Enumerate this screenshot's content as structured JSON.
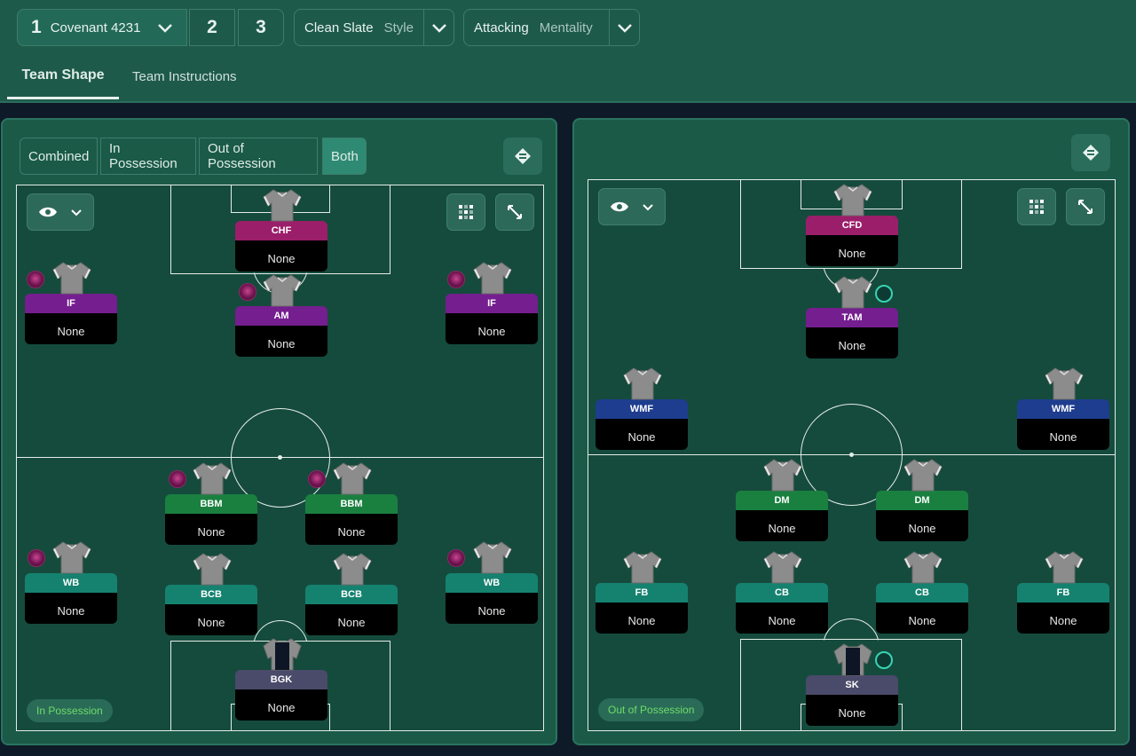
{
  "topbar": {
    "tactic": {
      "number": "1",
      "name": "Covenant 4231"
    },
    "slots": [
      "2",
      "3"
    ],
    "style": {
      "value": "Clean Slate",
      "label": "Style"
    },
    "mentality": {
      "value": "Attacking",
      "label": "Mentality"
    }
  },
  "tabs": {
    "team_shape": "Team Shape",
    "team_instructions": "Team Instructions"
  },
  "filters": {
    "combined": "Combined",
    "in_possession": "In Possession",
    "out_of_possession": "Out of Possession",
    "both": "Both",
    "selected": "Both"
  },
  "colors": {
    "accent": "#2e8a72",
    "pitch": "#154b3c",
    "panel": "#1a5a47",
    "role_magenta": "#9b1e6a",
    "role_purple": "#751e8f",
    "role_green": "#1a8040",
    "role_teal": "#158270",
    "role_blue": "#1e3d8f",
    "role_slate": "#4a4a6a",
    "phase_label": "#6fdc68"
  },
  "left_pitch": {
    "phase_label": "In Possession",
    "players": [
      {
        "role": "CHF",
        "name": "None",
        "color": "#9b1e6a"
      },
      {
        "role": "IF",
        "name": "None",
        "color": "#751e8f"
      },
      {
        "role": "AM",
        "name": "None",
        "color": "#751e8f"
      },
      {
        "role": "IF",
        "name": "None",
        "color": "#751e8f"
      },
      {
        "role": "BBM",
        "name": "None",
        "color": "#1a8040"
      },
      {
        "role": "BBM",
        "name": "None",
        "color": "#1a8040"
      },
      {
        "role": "WB",
        "name": "None",
        "color": "#158270"
      },
      {
        "role": "BCB",
        "name": "None",
        "color": "#158270"
      },
      {
        "role": "BCB",
        "name": "None",
        "color": "#158270"
      },
      {
        "role": "WB",
        "name": "None",
        "color": "#158270"
      },
      {
        "role": "BGK",
        "name": "None",
        "color": "#4a4a6a"
      }
    ]
  },
  "right_pitch": {
    "phase_label": "Out of Possession",
    "players": [
      {
        "role": "CFD",
        "name": "None",
        "color": "#9b1e6a"
      },
      {
        "role": "TAM",
        "name": "None",
        "color": "#751e8f"
      },
      {
        "role": "WMF",
        "name": "None",
        "color": "#1e3d8f"
      },
      {
        "role": "WMF",
        "name": "None",
        "color": "#1e3d8f"
      },
      {
        "role": "DM",
        "name": "None",
        "color": "#1a8040"
      },
      {
        "role": "DM",
        "name": "None",
        "color": "#1a8040"
      },
      {
        "role": "FB",
        "name": "None",
        "color": "#158270"
      },
      {
        "role": "CB",
        "name": "None",
        "color": "#158270"
      },
      {
        "role": "CB",
        "name": "None",
        "color": "#158270"
      },
      {
        "role": "FB",
        "name": "None",
        "color": "#158270"
      },
      {
        "role": "SK",
        "name": "None",
        "color": "#4a4a6a"
      }
    ]
  },
  "icons": {
    "view": "eye-icon",
    "dropdown": "chevron-down-icon",
    "grid": "grid-icon",
    "expand": "expand-icon",
    "swap": "swap-icon",
    "role_focus": "focus-bubble-icon"
  }
}
